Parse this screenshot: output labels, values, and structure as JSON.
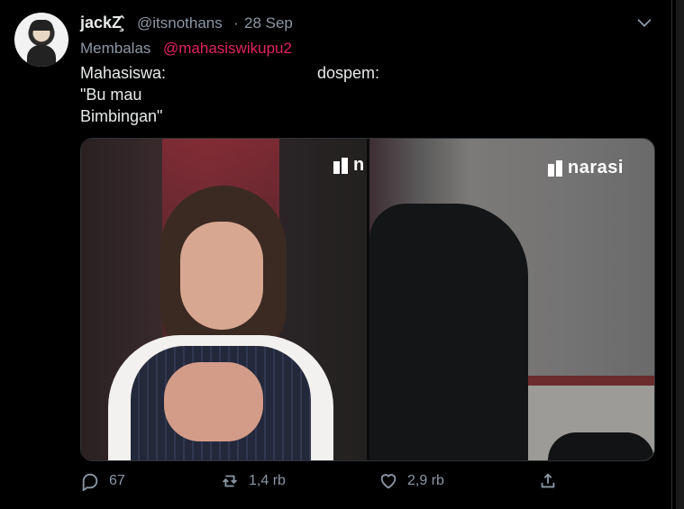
{
  "tweet": {
    "author_name": "jackΖ̧̂",
    "handle": "@itsnothans",
    "separator": "·",
    "date": "28 Sep",
    "reply_prefix": "Membalas",
    "reply_to": "@mahasiswikupu2",
    "lines": {
      "left_1": "Mahasiswa:",
      "left_2": "\"Bu mau",
      "left_3": "Bimbingan\"",
      "right_1": "dospem:"
    },
    "media": {
      "logo_left": "n",
      "logo_right": "narasi"
    },
    "actions": {
      "reply_count": "67",
      "retweet_count": "1,4 rb",
      "like_count": "2,9 rb"
    },
    "icons": [
      "chevron-down-icon",
      "reply-icon",
      "retweet-icon",
      "like-icon",
      "share-icon"
    ]
  }
}
